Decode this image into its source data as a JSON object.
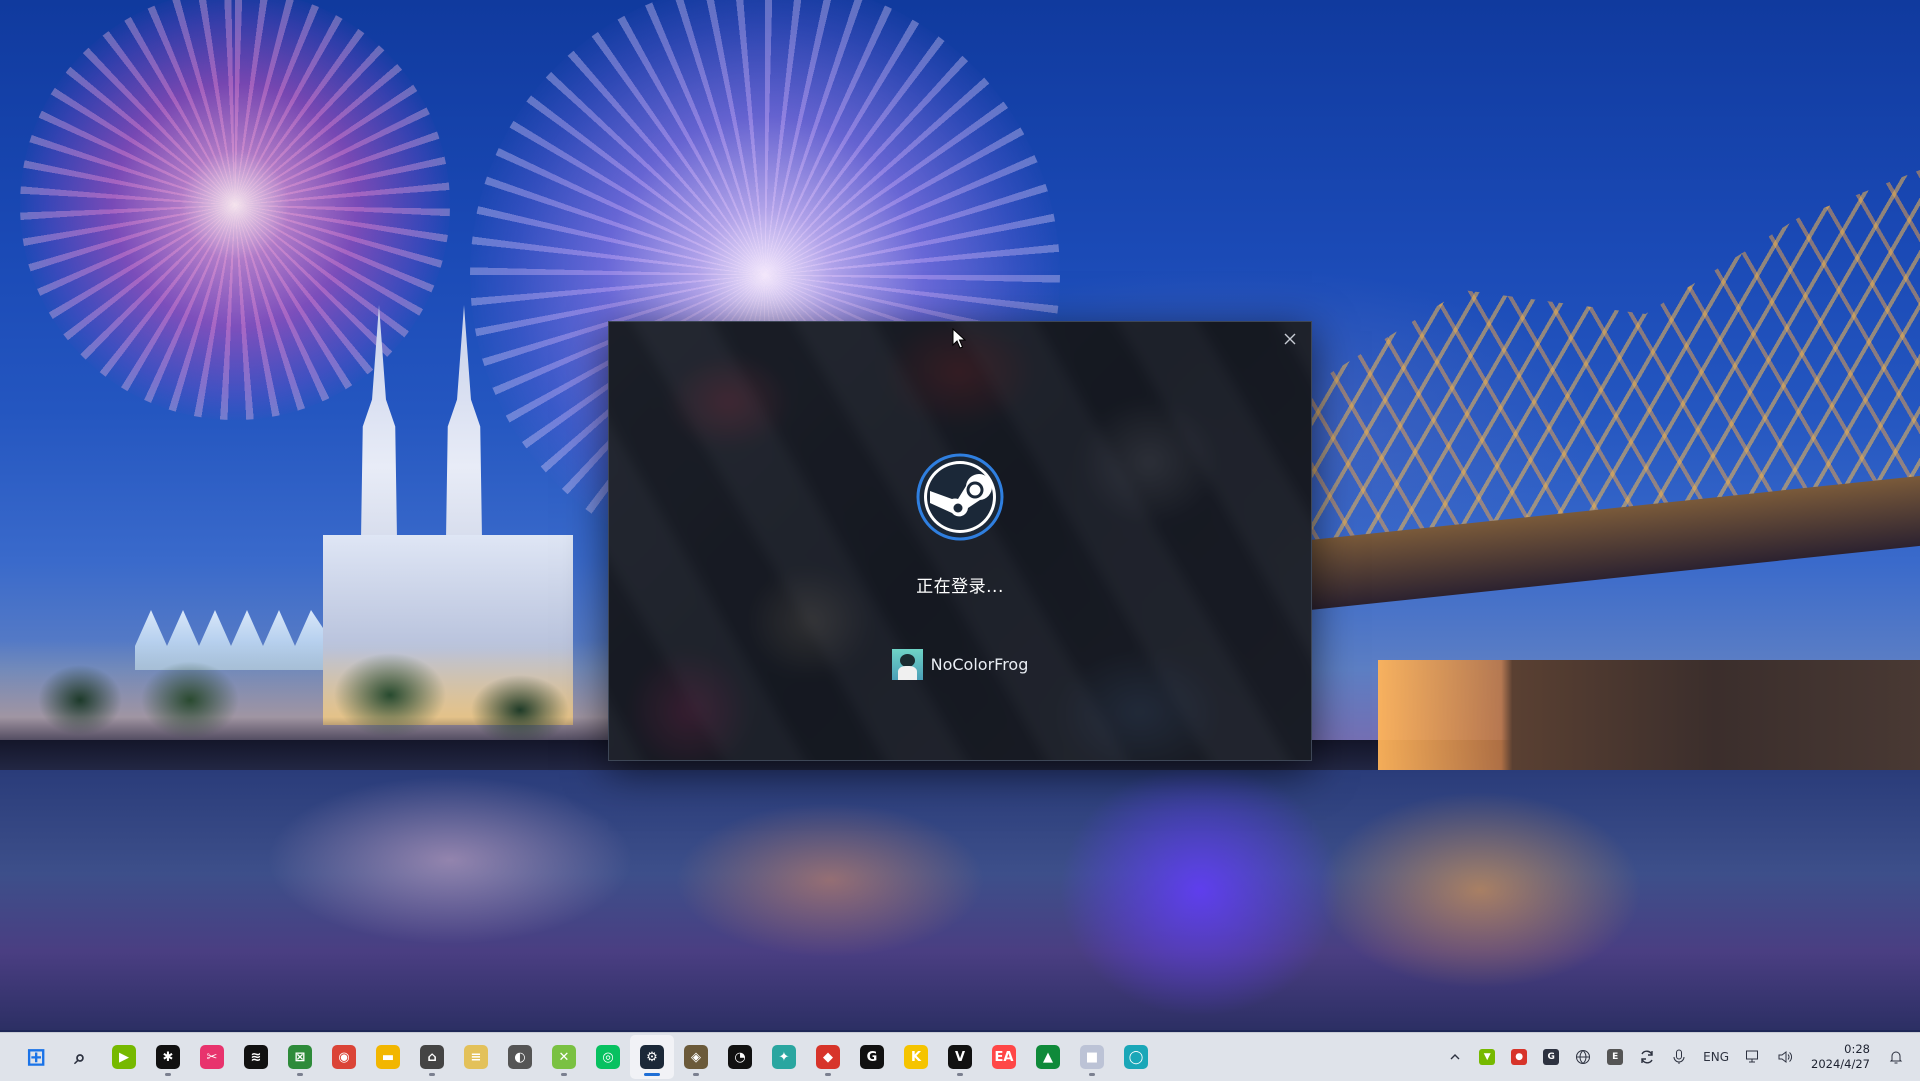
{
  "dialog": {
    "status": "正在登录...",
    "account_name": "NoColorFrog"
  },
  "taskbar": {
    "apps": [
      {
        "name": "start-button",
        "icon": "windows-start-icon",
        "color": "#1a73e8"
      },
      {
        "name": "search",
        "icon": "search-icon",
        "color": "#2d3240"
      },
      {
        "name": "nvidia",
        "icon": "nvidia-icon",
        "color": "#76b900"
      },
      {
        "name": "davinci",
        "icon": "davinci-resolve-icon",
        "color": "#111111"
      },
      {
        "name": "snipping",
        "icon": "snipping-tool-icon",
        "color": "#e8336d"
      },
      {
        "name": "capcut",
        "icon": "capcut-icon",
        "color": "#111111"
      },
      {
        "name": "xbox-app",
        "icon": "xbox-app-icon",
        "color": "#2e8b3a"
      },
      {
        "name": "chrome",
        "icon": "chrome-icon",
        "color": "#db4437"
      },
      {
        "name": "file-explorer",
        "icon": "folder-icon",
        "color": "#f2b600"
      },
      {
        "name": "game-controller",
        "icon": "gamepad-icon",
        "color": "#444444"
      },
      {
        "name": "notepad",
        "icon": "notepad-icon",
        "color": "#e3c15a"
      },
      {
        "name": "epic-launcher",
        "icon": "epic-icon",
        "color": "#555555"
      },
      {
        "name": "xbox",
        "icon": "xbox-icon",
        "color": "#7ac142"
      },
      {
        "name": "wechat",
        "icon": "wechat-icon",
        "color": "#07c160"
      },
      {
        "name": "steam",
        "icon": "steam-icon",
        "color": "#1b2838"
      },
      {
        "name": "hoyoplay",
        "icon": "game-launcher-icon",
        "color": "#6b5a3a"
      },
      {
        "name": "speedtest",
        "icon": "gauge-icon",
        "color": "#111111"
      },
      {
        "name": "launcher-genshin",
        "icon": "genshin-icon",
        "color": "#2aa6a0"
      },
      {
        "name": "launcher-red",
        "icon": "red-app-icon",
        "color": "#d7342a"
      },
      {
        "name": "logitech",
        "icon": "logitech-g-icon",
        "color": "#111111"
      },
      {
        "name": "kook",
        "icon": "kook-icon",
        "color": "#f5c400"
      },
      {
        "name": "valorant",
        "icon": "valorant-icon",
        "color": "#111111"
      },
      {
        "name": "ea",
        "icon": "ea-icon",
        "color": "#ff4747"
      },
      {
        "name": "gog-like",
        "icon": "triangle-app-icon",
        "color": "#0f8a3a"
      },
      {
        "name": "white-cube",
        "icon": "cube-icon",
        "color": "#bcc3d6"
      },
      {
        "name": "ring-app",
        "icon": "ring-icon",
        "color": "#1aa7b8"
      }
    ],
    "active_app": "steam",
    "tray": {
      "icons": [
        "chevron-up-icon",
        "nvidia-tray-icon",
        "red-tray-icon",
        "logitech-tray-icon",
        "network-globe-icon",
        "epic-tray-icon",
        "sync-icon",
        "microphone-icon"
      ],
      "language": "ENG",
      "time": "0:28",
      "date": "2024/4/27"
    }
  }
}
